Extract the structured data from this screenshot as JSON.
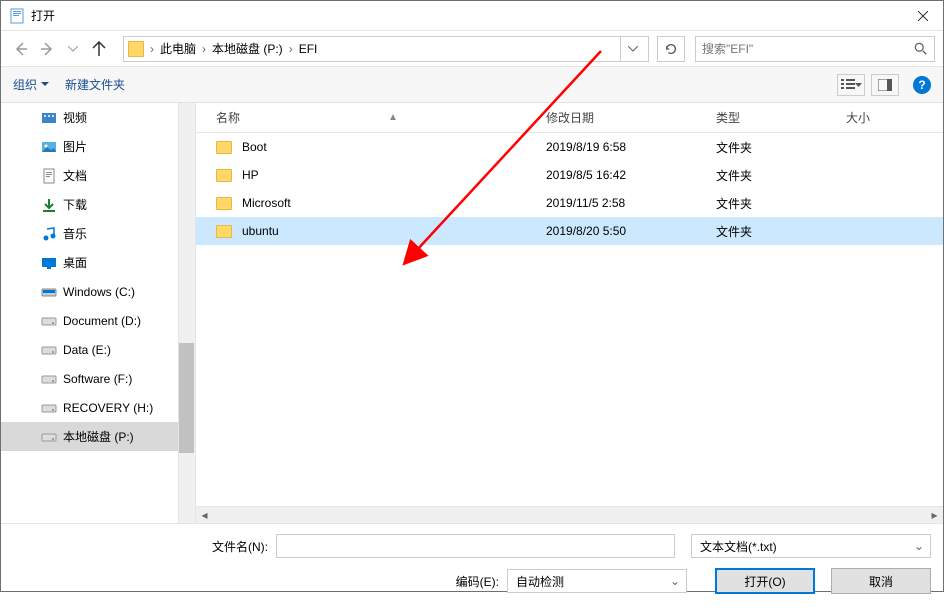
{
  "title": "打开",
  "breadcrumb": {
    "items": [
      "此电脑",
      "本地磁盘 (P:)",
      "EFI"
    ]
  },
  "search": {
    "placeholder": "搜索\"EFI\""
  },
  "toolbar": {
    "organize": "组织",
    "new_folder": "新建文件夹"
  },
  "columns": {
    "name": "名称",
    "date": "修改日期",
    "type": "类型",
    "size": "大小"
  },
  "files": [
    {
      "name": "Boot",
      "date": "2019/8/19 6:58",
      "type": "文件夹",
      "selected": false
    },
    {
      "name": "HP",
      "date": "2019/8/5 16:42",
      "type": "文件夹",
      "selected": false
    },
    {
      "name": "Microsoft",
      "date": "2019/11/5 2:58",
      "type": "文件夹",
      "selected": false
    },
    {
      "name": "ubuntu",
      "date": "2019/8/20 5:50",
      "type": "文件夹",
      "selected": true
    }
  ],
  "sidebar": {
    "items": [
      {
        "label": "视频",
        "icon": "video"
      },
      {
        "label": "图片",
        "icon": "pictures"
      },
      {
        "label": "文档",
        "icon": "documents"
      },
      {
        "label": "下载",
        "icon": "downloads"
      },
      {
        "label": "音乐",
        "icon": "music"
      },
      {
        "label": "桌面",
        "icon": "desktop"
      },
      {
        "label": "Windows (C:)",
        "icon": "drive"
      },
      {
        "label": "Document (D:)",
        "icon": "drive-ext"
      },
      {
        "label": "Data (E:)",
        "icon": "drive-ext"
      },
      {
        "label": "Software (F:)",
        "icon": "drive-ext"
      },
      {
        "label": "RECOVERY (H:)",
        "icon": "drive-ext"
      },
      {
        "label": "本地磁盘 (P:)",
        "icon": "drive-ext",
        "selected": true
      }
    ]
  },
  "footer": {
    "filename_label": "文件名(N):",
    "filter_value": "文本文档(*.txt)",
    "encoding_label": "编码(E):",
    "encoding_value": "自动检测",
    "open_label": "打开(O)",
    "cancel_label": "取消"
  }
}
